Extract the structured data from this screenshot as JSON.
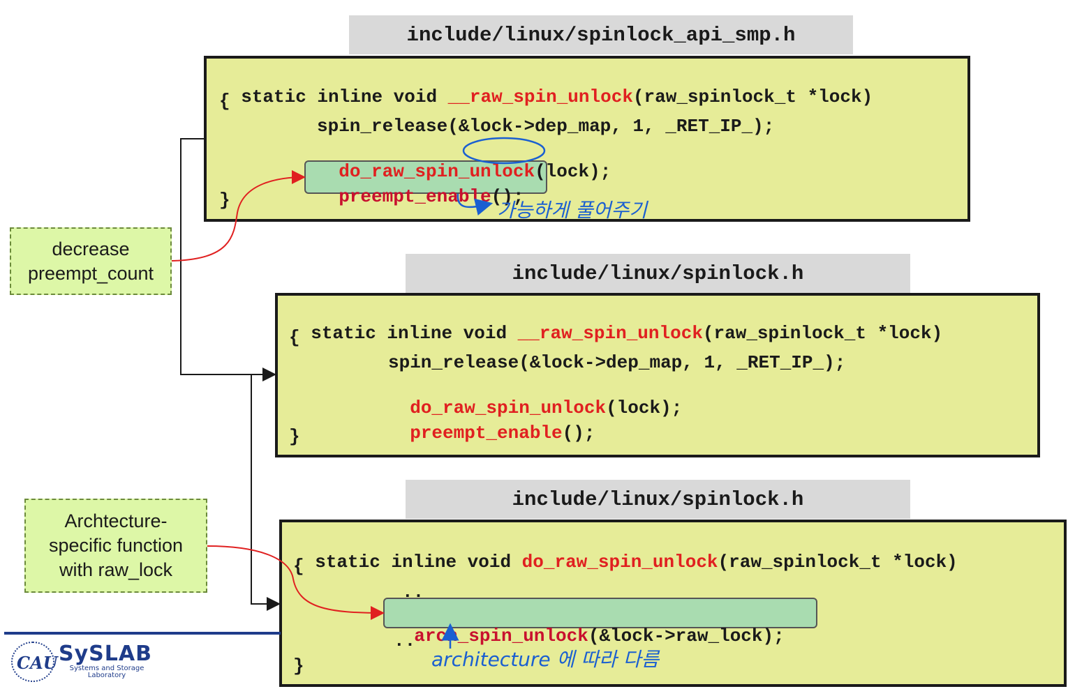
{
  "blocks": [
    {
      "file": "include/linux/spinlock_api_smp.h",
      "sig_prefix": "static inline void ",
      "sig_fn": "__raw_spin_unlock",
      "sig_suffix": "(raw_spinlock_t *lock)",
      "open": "{",
      "line1": "spin_release(&lock->dep_map, 1, _RET_IP_);",
      "line2_fn": "do_raw_spin_unlock",
      "line2_rest": "(lock);",
      "line3_fn": "preempt_enable",
      "line3_rest": "();",
      "close": "}"
    },
    {
      "file": "include/linux/spinlock.h",
      "sig_prefix": "static inline void ",
      "sig_fn": "__raw_spin_unlock",
      "sig_suffix": "(raw_spinlock_t *lock)",
      "open": "{",
      "line1": "spin_release(&lock->dep_map, 1, _RET_IP_);",
      "line2_fn": "do_raw_spin_unlock",
      "line2_rest": "(lock);",
      "line3_fn": "preempt_enable",
      "line3_rest": "();",
      "close": "}"
    },
    {
      "file": "include/linux/spinlock.h",
      "sig_prefix": "static inline void ",
      "sig_fn": "do_raw_spin_unlock",
      "sig_suffix": "(raw_spinlock_t *lock)",
      "open": "{",
      "dots1": "..",
      "line_fn": "arch_spin_unlock",
      "line_rest": "(&lock->raw_lock);",
      "dots2": "..",
      "close": "}"
    }
  ],
  "notes": {
    "preempt": "decrease\npreempt_count",
    "arch": "Archtecture-\nspecific function\nwith raw_lock"
  },
  "handwriting": {
    "korean": "가능하게 풀어주기",
    "arch": "architecture 에 따라 다름"
  },
  "logo": {
    "cau": "CAU",
    "name": "SySLAB",
    "subtitle": "Systems and Storage Laboratory"
  },
  "colors": {
    "code_bg": "#e6ec98",
    "highlight_bg": "#a9dcb0",
    "note_bg": "#ddf7a7",
    "header_bg": "#d9d9d9",
    "function_red": "#e02020",
    "annotation_blue": "#1a5fd1"
  }
}
